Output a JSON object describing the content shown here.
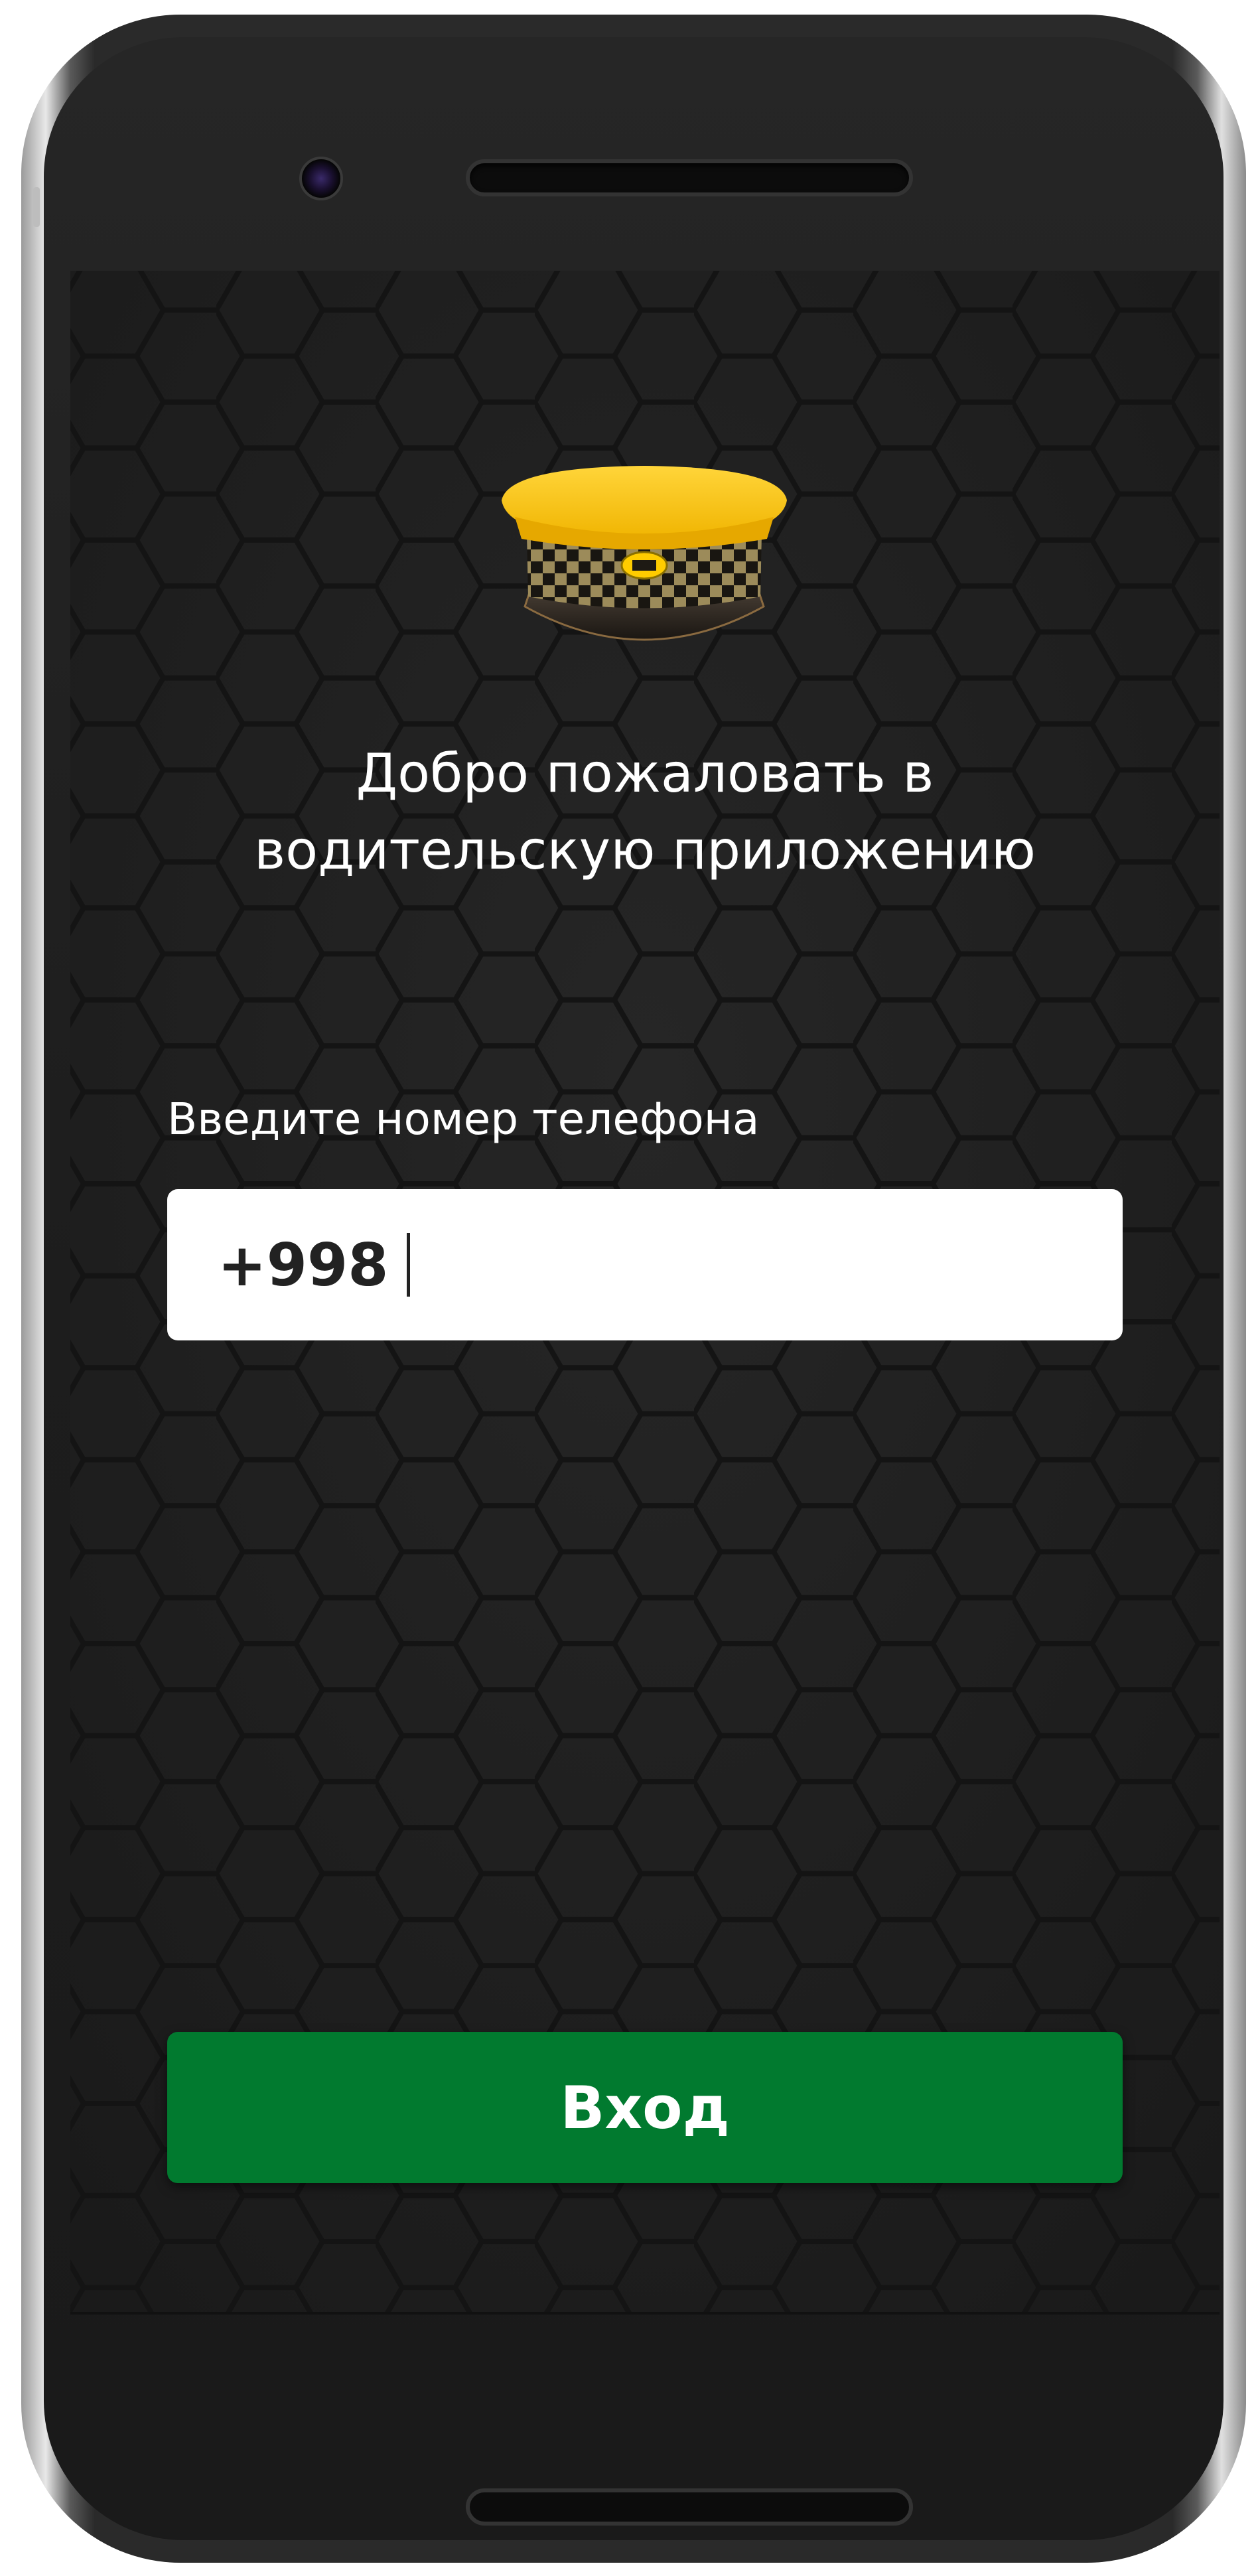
{
  "welcome": {
    "line1": "Добро пожаловать в",
    "line2": "водительскую приложению"
  },
  "phone": {
    "label": "Введите номер телефона",
    "prefix": "+998"
  },
  "login": {
    "label": "Вход"
  },
  "colors": {
    "button": "#017a2f",
    "background": "#1c1c1c",
    "cap_yellow": "#ffc61a"
  },
  "icons": {
    "logo": "taxi-driver-cap-icon"
  }
}
